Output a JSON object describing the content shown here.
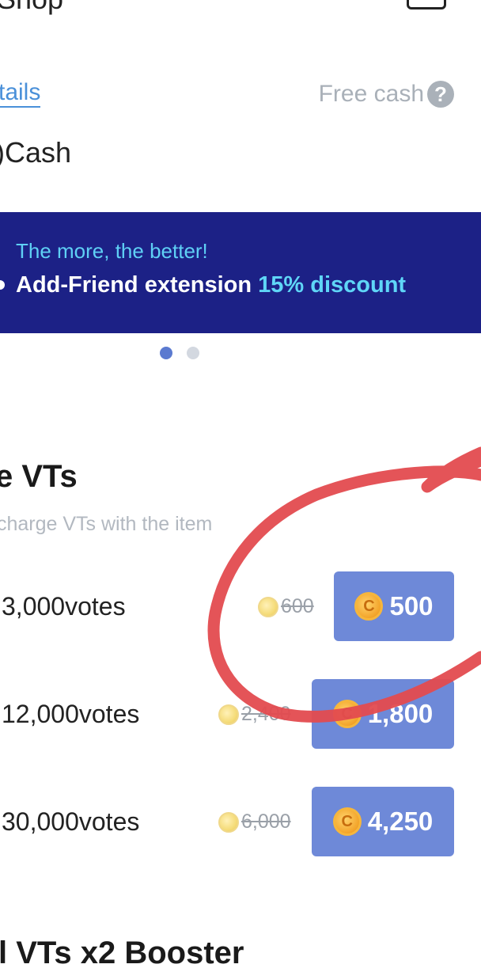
{
  "header": {
    "title": "Shop"
  },
  "account": {
    "details_link": "tails",
    "free_cash_label": "Free cash",
    "help_icon": "question-circle-icon",
    "cash_label": ")Cash"
  },
  "banner": {
    "line1": "The more, the better!",
    "line2_prefix": "Add-Friend extension ",
    "line2_highlight": "15% discount",
    "background": "#1c2186",
    "highlight_color": "#5fd6f7",
    "active_page": 1,
    "page_count": 2
  },
  "votes_section": {
    "title": "e VTs",
    "subtitle": "charge VTs with the item",
    "items": [
      {
        "label": "3,000votes",
        "old_price": "600",
        "price": "500"
      },
      {
        "label": "12,000votes",
        "old_price": "2,400",
        "price": "1,800"
      },
      {
        "label": "30,000votes",
        "old_price": "6,000",
        "price": "4,250"
      }
    ]
  },
  "booster_section": {
    "title": "l VTs x2 Booster"
  },
  "colors": {
    "button": "#6e89d8",
    "link": "#4a90d9",
    "annotation": "#e34b4f"
  },
  "icons": {
    "coin": "coin-icon",
    "menu": "menu-icon"
  }
}
